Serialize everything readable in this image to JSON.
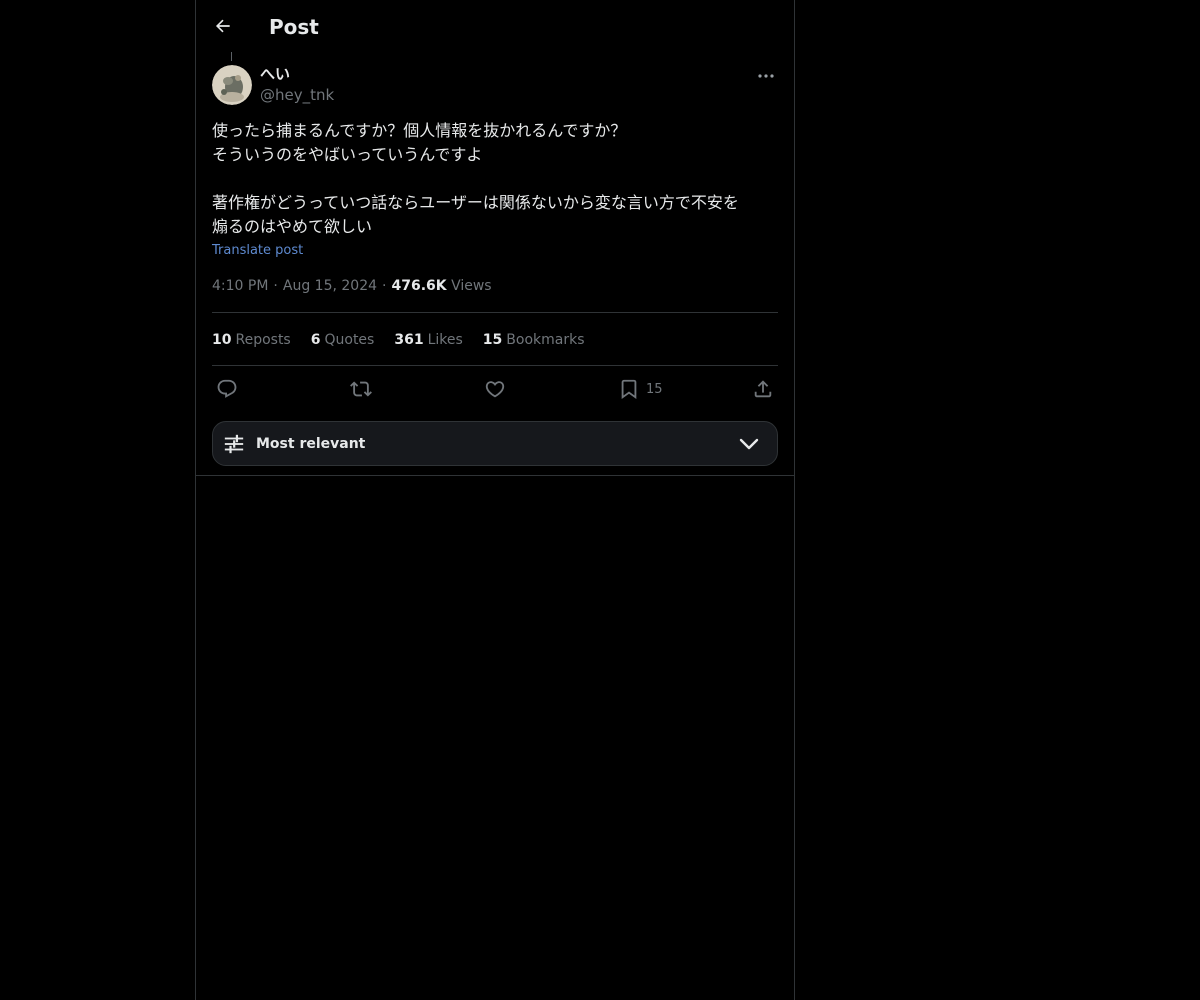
{
  "header": {
    "title": "Post",
    "back_icon": "arrow-left-icon"
  },
  "post": {
    "author_name": "へい",
    "author_handle": "@hey_tnk",
    "avatar_icon": "user-avatar",
    "more_icon": "more-horizontal-icon",
    "text_lines": [
      "使ったら捕まるんですか？個人情報を抜かれるんですか？",
      "そういうのをやばいっていうんですよ",
      "",
      "著作権がどうっていつ話ならユーザーは関係ないから変な言い方で不安を",
      "煽るのはやめて欲しい"
    ],
    "translate_label": "Translate post",
    "time": "4:10 PM",
    "date": "Aug 15, 2024",
    "views_count": "476.6K",
    "views_label": "Views",
    "separator": "·"
  },
  "stats": {
    "reposts_count": "10",
    "reposts_label": "Reposts",
    "quotes_count": "6",
    "quotes_label": "Quotes",
    "likes_count": "361",
    "likes_label": "Likes",
    "bookmarks_count": "15",
    "bookmarks_label": "Bookmarks"
  },
  "actions": {
    "reply_icon": "reply-icon",
    "repost_icon": "repost-icon",
    "like_icon": "heart-icon",
    "bookmark_icon": "bookmark-icon",
    "bookmark_count": "15",
    "share_icon": "share-icon"
  },
  "sort": {
    "label": "Most relevant",
    "icon": "sliders-icon",
    "chevron": "chevron-down-icon"
  },
  "colors": {
    "background": "#000000",
    "text_primary": "#e7e9ea",
    "text_secondary": "#71767b",
    "link": "#5e8ad0",
    "border": "#2f3336",
    "sort_bg": "#16181c"
  }
}
